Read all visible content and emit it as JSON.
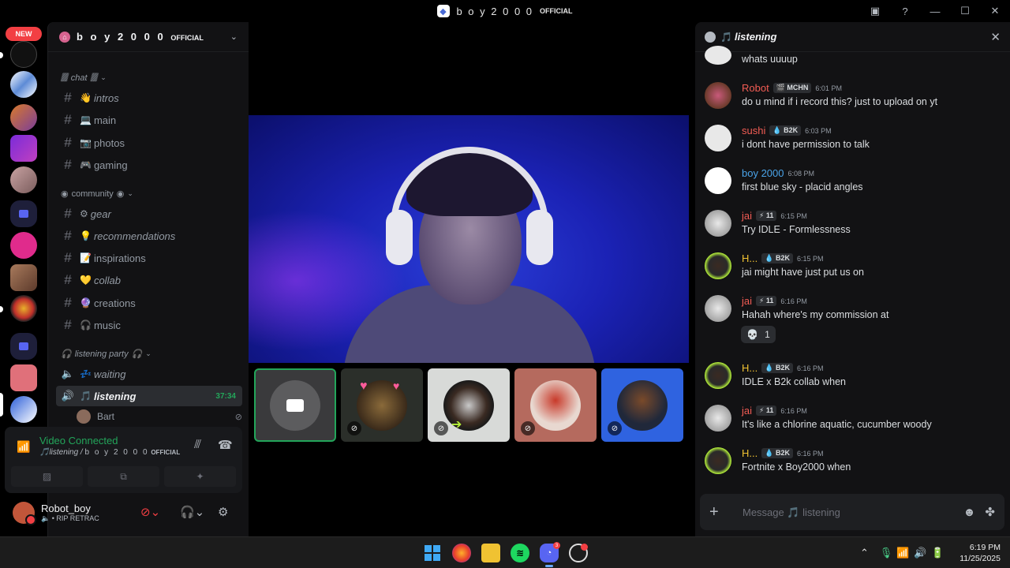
{
  "window": {
    "title_main": "b o y 2 0 0 0",
    "title_suffix": "OFFICIAL"
  },
  "rail": {
    "new_badge": "NEW"
  },
  "server": {
    "name_main": "b o y 2 0 0 0",
    "name_suffix": "OFFICIAL"
  },
  "categories": {
    "chat": "chat",
    "community": "community",
    "listening": "listening party"
  },
  "channels": [
    {
      "label": "intros",
      "emoji": "👋",
      "italic": true
    },
    {
      "label": "main",
      "emoji": "💻",
      "italic": false
    },
    {
      "label": "photos",
      "emoji": "📷",
      "italic": false
    },
    {
      "label": "gaming",
      "emoji": "🎮",
      "italic": false
    },
    {
      "label": "gear",
      "emoji": "⚙",
      "italic": true
    },
    {
      "label": "recommendations",
      "emoji": "💡",
      "italic": true
    },
    {
      "label": "inspirations",
      "emoji": "📝",
      "italic": false
    },
    {
      "label": "collab",
      "emoji": "💛",
      "italic": true
    },
    {
      "label": "creations",
      "emoji": "🔮",
      "italic": false
    },
    {
      "label": "music",
      "emoji": "🎧",
      "italic": false
    }
  ],
  "voice_channels": [
    {
      "label": "waiting",
      "emoji": "💤"
    },
    {
      "label": "listening",
      "emoji": "🎵",
      "timer": "37:34"
    }
  ],
  "voice_user": {
    "name": "Bart"
  },
  "voice_panel": {
    "status": "Video Connected",
    "channel": "listening",
    "separator": " / ",
    "server_main": "b o y 2 0 0 0",
    "server_suffix": "OFFICIAL"
  },
  "user": {
    "name": "Robot_boy",
    "status": "RIP RETRAC"
  },
  "chat": {
    "title": "listening",
    "messages": [
      {
        "author": "",
        "tag": "",
        "time": "",
        "body": "whats uuuup",
        "color": "#f2f3f5"
      },
      {
        "author": "Robot",
        "tag": "MCHN",
        "time": "6:01 PM",
        "body": "do u mind if i record this? just to upload on yt",
        "color": "#f25c54"
      },
      {
        "author": "sushi",
        "tag": "B2K",
        "time": "6:03 PM",
        "body": "i dont have permission to talk",
        "color": "#f25c54"
      },
      {
        "author": "boy 2000",
        "tag": "",
        "time": "6:08 PM",
        "body": "first blue sky - placid angles",
        "color": "#4aa3e8"
      },
      {
        "author": "jai",
        "tag": "11",
        "time": "6:15 PM",
        "body": "Try IDLE - Formlessness",
        "color": "#f25c54"
      },
      {
        "author": "H...",
        "tag": "B2K",
        "time": "6:15 PM",
        "body": "jai might have just put us on",
        "color": "#f0c232"
      },
      {
        "author": "jai",
        "tag": "11",
        "time": "6:16 PM",
        "body": "Hahah where's my commission at",
        "color": "#f25c54"
      },
      {
        "author": "H...",
        "tag": "B2K",
        "time": "6:16 PM",
        "body": "IDLE x B2k collab when",
        "color": "#f0c232"
      },
      {
        "author": "jai",
        "tag": "11",
        "time": "6:16 PM",
        "body": "It's like a chlorine aquatic, cucumber  woody",
        "color": "#f25c54"
      },
      {
        "author": "H...",
        "tag": "B2K",
        "time": "6:16 PM",
        "body": "Fortnite x Boy2000 when",
        "color": "#f0c232"
      }
    ],
    "reaction": {
      "emoji": "💀",
      "count": "1"
    },
    "composer_placeholder": "Message 🎵 listening"
  },
  "taskbar": {
    "discord_badge": "3",
    "time": "6:19 PM",
    "date": "11/25/2025"
  }
}
